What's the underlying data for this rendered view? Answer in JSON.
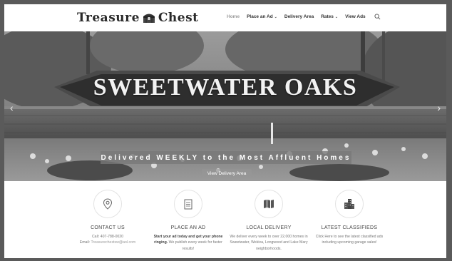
{
  "header": {
    "logo_text_left": "Treasure",
    "logo_text_right": "Chest",
    "nav": [
      {
        "label": "Home",
        "active": true
      },
      {
        "label": "Place an Ad",
        "dropdown": true
      },
      {
        "label": "Delivery Area"
      },
      {
        "label": "Rates",
        "dropdown": true
      },
      {
        "label": "View Ads"
      }
    ],
    "search_icon": "search-icon"
  },
  "hero": {
    "sign_text": "SWEETWATER OAKS",
    "tagline": "Delivered WEEKLY to the Most Affluent Homes",
    "button_label": "View Delivery Area",
    "prev_icon": "chevron-left-icon",
    "next_icon": "chevron-right-icon"
  },
  "features": [
    {
      "icon": "location-pin-icon",
      "title": "CONTACT US",
      "line1": "Call: 407-788-0020",
      "line2_prefix": "Email: ",
      "line2_link": "Treasurechestsw@aol.com"
    },
    {
      "icon": "document-icon",
      "title": "PLACE AN AD",
      "bold_text": "Start your ad today and get your phone ringing.",
      "rest_text": " We publish every week for faster results!"
    },
    {
      "icon": "map-icon",
      "title": "LOCAL DELIVERY",
      "text": "We deliver every week to over 22,000 homes in Sweetwater, Wekiva, Longwood and Lake Mary neighborhoods."
    },
    {
      "icon": "buildings-icon",
      "title": "LATEST CLASSIFIEDS",
      "text": "Click Here to see the latest classified ads including upcoming garage sales!"
    }
  ]
}
